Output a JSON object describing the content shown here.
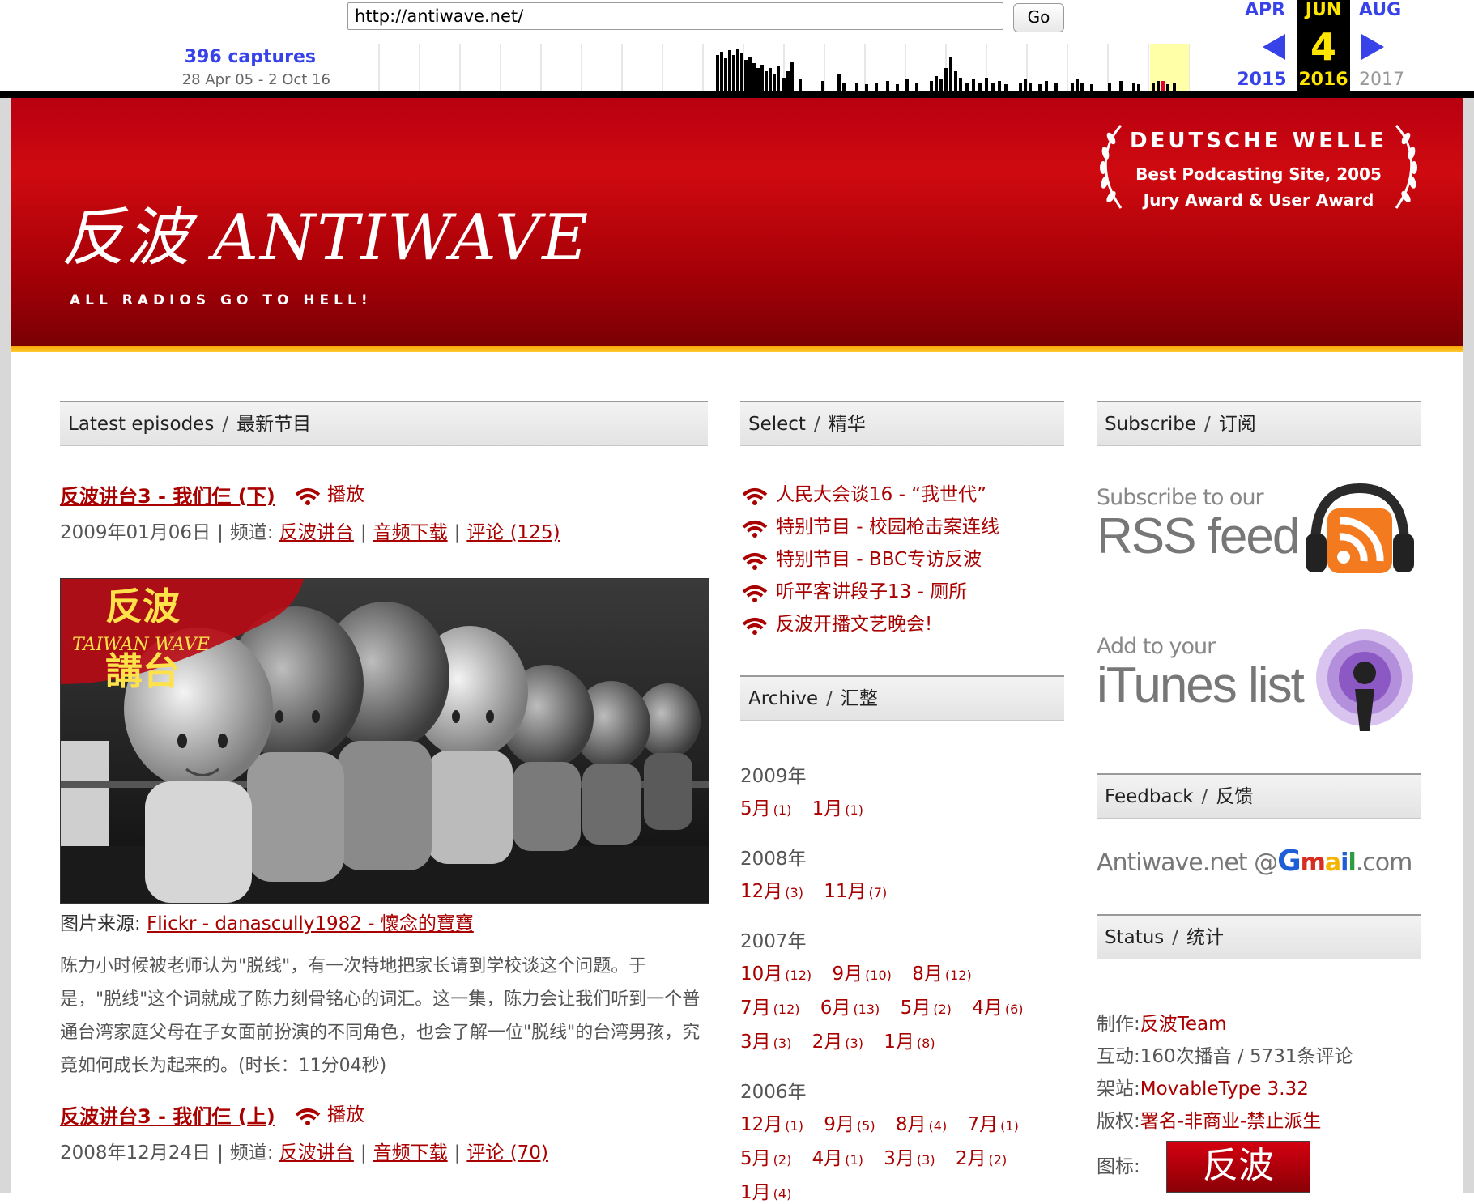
{
  "wayback": {
    "url": "http://antiwave.net/",
    "go_label": "Go",
    "captures": "396 captures",
    "range": "28 Apr 05 - 2 Oct 16",
    "prev_month": "APR",
    "cur_month": "JUN",
    "next_month": "AUG",
    "cur_day": "4",
    "prev_year": "2015",
    "cur_year": "2016",
    "next_year": "2017"
  },
  "header": {
    "logo": "反波 ANTIWAVE",
    "tagline": "ALL RADIOS GO TO HELL!",
    "award_title": "DEUTSCHE WELLE",
    "award_line1": "Best Podcasting Site, 2005",
    "award_line2": "Jury Award & User Award"
  },
  "latest": {
    "heading_en": "Latest episodes",
    "sep": "/",
    "heading_zh": "最新节目",
    "episodes": [
      {
        "title": "反波讲台3 - 我们仨 (下)",
        "play": "播放",
        "date": "2009年01月06日",
        "channel_label": "频道:",
        "channel": "反波讲台",
        "download": "音频下载",
        "comments": "评论 (125)"
      },
      {
        "title": "反波讲台3 - 我们仨 (上)",
        "play": "播放",
        "date": "2008年12月24日",
        "channel_label": "频道:",
        "channel": "反波讲台",
        "download": "音频下载",
        "comments": "评论 (70)"
      }
    ],
    "image_logo_top": "反波",
    "image_logo_mid": "TAIWAN WAVE",
    "image_logo_bottom": "講台",
    "credit_label": "图片来源:",
    "credit_link": "Flickr - danascully1982 - 懷念的寶寶",
    "description": "陈力小时候被老师认为\"脱线\"，有一次特地把家长请到学校谈这个问题。于是，\"脱线\"这个词就成了陈力刻骨铭心的词汇。这一集，陈力会让我们听到一个普通台湾家庭父母在子女面前扮演的不同角色，也会了解一位\"脱线\"的台湾男孩，究竟如何成长为起来的。(时长：11分04秒)"
  },
  "select": {
    "heading_en": "Select",
    "sep": "/",
    "heading_zh": "精华",
    "items": [
      "人民大会谈16 - “我世代”",
      "特别节目 - 校园枪击案连线",
      "特别节目 - BBC专访反波",
      "听平客讲段子13 - 厕所",
      "反波开播文艺晚会!"
    ]
  },
  "archive": {
    "heading_en": "Archive",
    "sep": "/",
    "heading_zh": "汇整",
    "years": [
      {
        "year": "2009年",
        "rows": [
          [
            [
              "5月",
              "(1)"
            ],
            [
              "1月",
              "(1)"
            ]
          ]
        ]
      },
      {
        "year": "2008年",
        "rows": [
          [
            [
              "12月",
              "(3)"
            ],
            [
              "11月",
              "(7)"
            ]
          ]
        ]
      },
      {
        "year": "2007年",
        "rows": [
          [
            [
              "10月",
              "(12)"
            ],
            [
              "9月",
              "(10)"
            ],
            [
              "8月",
              "(12)"
            ]
          ],
          [
            [
              "7月",
              "(12)"
            ],
            [
              "6月",
              "(13)"
            ],
            [
              "5月",
              "(2)"
            ],
            [
              "4月",
              "(6)"
            ]
          ],
          [
            [
              "3月",
              "(3)"
            ],
            [
              "2月",
              "(3)"
            ],
            [
              "1月",
              "(8)"
            ]
          ]
        ]
      },
      {
        "year": "2006年",
        "rows": [
          [
            [
              "12月",
              "(1)"
            ],
            [
              "9月",
              "(5)"
            ],
            [
              "8月",
              "(4)"
            ],
            [
              "7月",
              "(1)"
            ]
          ],
          [
            [
              "5月",
              "(2)"
            ],
            [
              "4月",
              "(1)"
            ],
            [
              "3月",
              "(3)"
            ],
            [
              "2月",
              "(2)"
            ]
          ],
          [
            [
              "1月",
              "(4)"
            ]
          ]
        ]
      }
    ]
  },
  "subscribe": {
    "heading_en": "Subscribe",
    "sep": "/",
    "heading_zh": "订阅",
    "rss_small": "Subscribe to our",
    "rss_big": "RSS feed",
    "itunes_small": "Add to your",
    "itunes_big": "iTunes list"
  },
  "feedback": {
    "heading_en": "Feedback",
    "sep": "/",
    "heading_zh": "反馈",
    "email_prefix": "Antiwave.net @",
    "email_g": "G",
    "email_m": "m",
    "email_a": "a",
    "email_i": "i",
    "email_l": "l",
    "email_suffix": ".com"
  },
  "status": {
    "heading_en": "Status",
    "sep": "/",
    "heading_zh": "统计",
    "rows": [
      {
        "label": "制作:",
        "value": "反波Team"
      },
      {
        "label": "互动:",
        "value": "160次播音 / 5731条评论"
      },
      {
        "label": "架站:",
        "value": "MovableType 3.32"
      },
      {
        "label": "版权:",
        "value": "署名-非商业-禁止派生"
      }
    ],
    "icon_label": "图标:",
    "icon_text": "反波"
  },
  "colors": {
    "accent": "#a90000",
    "header_red": "#c4000c",
    "stripe": "#f4a400",
    "wayback_blue": "#3742e8",
    "wayback_yellow": "#ffe500"
  }
}
